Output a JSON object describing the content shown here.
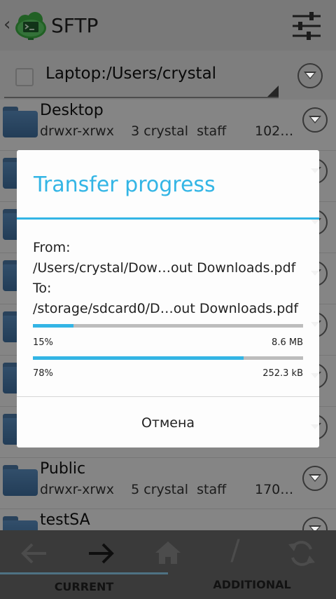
{
  "app": {
    "title": "SFTP",
    "back_glyph": "‹",
    "icon": "cloud-terminal-icon"
  },
  "path": {
    "value": "Laptop:/Users/crystal"
  },
  "files": [
    {
      "name": "Desktop",
      "perms": "drwxr-xrwx",
      "links": "3",
      "owner": "crystal",
      "group": "staff",
      "size": "102…"
    },
    {
      "name": "Public",
      "perms": "drwxr-xrwx",
      "links": "5",
      "owner": "crystal",
      "group": "staff",
      "size": "170…"
    },
    {
      "name": "testSA",
      "perms": "",
      "links": "",
      "owner": "",
      "group": "",
      "size": ""
    }
  ],
  "toolbar": {
    "icons": [
      "arrow-left-icon",
      "arrow-right-icon",
      "home-icon",
      "root-slash-icon",
      "refresh-icon"
    ],
    "root_glyph": "/",
    "tab_current": "CURRENT",
    "tab_additional": "ADDITIONAL"
  },
  "dialog": {
    "title": "Transfer progress",
    "from_label": "From:",
    "from_path": "/Users/crystal/Dow…out Downloads.pdf",
    "to_label": "To:",
    "to_path": "/storage/sdcard0/D…out Downloads.pdf",
    "progress1": {
      "percent_text": "15%",
      "fraction": 0.15,
      "amount": "8.6 MB"
    },
    "progress2": {
      "percent_text": "78%",
      "fraction": 0.78,
      "amount": "252.3 kB"
    },
    "cancel_label": "Отмена"
  },
  "colors": {
    "accent": "#33b5e5",
    "folder": "#4f82b5",
    "app_icon": "#3cb043"
  }
}
